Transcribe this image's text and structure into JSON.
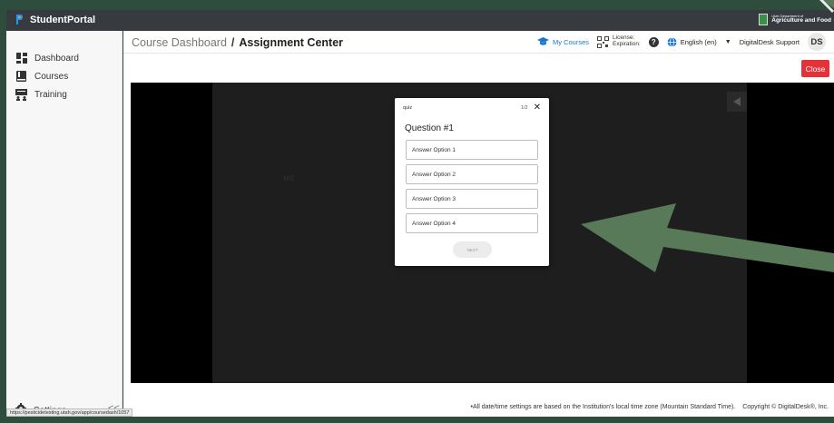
{
  "app": {
    "brand": "StudentPortal",
    "agency_small": "Utah Department of",
    "agency_big": "Agriculture and Food"
  },
  "sidebar": {
    "items": [
      {
        "label": "Dashboard",
        "icon": "dashboard-icon"
      },
      {
        "label": "Courses",
        "icon": "book-icon"
      },
      {
        "label": "Training",
        "icon": "training-icon"
      }
    ],
    "settings_label": "Settings",
    "collapse_label": "<<"
  },
  "status_url": "https://pesticidetesting.utah.gov/app/coursedash/1057",
  "header": {
    "crumb_root": "Course Dashboard",
    "crumb_sep": "/",
    "crumb_current": "Assignment Center",
    "my_courses": "My Courses",
    "license_label": "License:",
    "expiration_label": "Expiration:",
    "language": "English (en)",
    "user_name": "DigitalDesk Support",
    "avatar_initials": "DS"
  },
  "close_label": "Close",
  "stage_text": "od",
  "quiz": {
    "label": "quiz",
    "counter": "1/2",
    "question": "Question #1",
    "options": [
      "Answer Option 1",
      "Answer Option 2",
      "Answer Option 3",
      "Answer Option 4"
    ],
    "next_label": "NEXT"
  },
  "footer": {
    "note": "•All date/time settings are based on the Institution's local time zone (Mountain Standard Time).",
    "copyright": "Copyright © DigitalDesk®, Inc."
  },
  "colors": {
    "frame": "#2e4d3c",
    "annotation_arrow": "#587a58",
    "close_button": "#e53238",
    "accent": "#1976d2"
  }
}
